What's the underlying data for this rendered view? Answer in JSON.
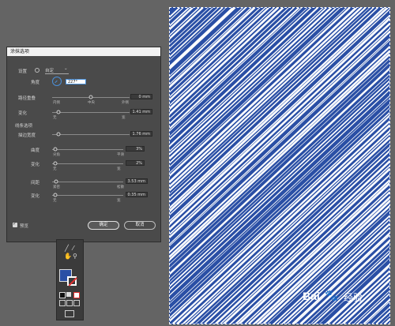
{
  "dialog": {
    "title": "涂抹选项",
    "settings_label": "设置",
    "settings_value": "自定",
    "angle_label": "角度",
    "angle_value": "227°",
    "path_overlap_label": "路径重叠",
    "path_overlap_value": "0 mm",
    "path_overlap_ticks": [
      "内侧",
      "中央",
      "外侧"
    ],
    "variation1_label": "变化",
    "variation1_value": "1.41 mm",
    "variation1_ticks": [
      "无",
      "宽"
    ],
    "line_options_label": "线条选项",
    "stroke_width_label": "描边宽度",
    "stroke_width_value": "1.76 mm",
    "curviness_label": "曲度",
    "curviness_value": "3%",
    "curviness_ticks": [
      "尖角",
      "平滑"
    ],
    "variation2_label": "变化",
    "variation2_value": "2%",
    "variation2_ticks": [
      "无",
      "宽"
    ],
    "spacing_label": "间距",
    "spacing_value": "3.53 mm",
    "spacing_ticks": [
      "紧密",
      "松散"
    ],
    "variation3_label": "变化",
    "variation3_value": "0.35 mm",
    "variation3_ticks": [
      "无",
      "宽"
    ],
    "preview_label": "预览",
    "ok_label": "确定",
    "cancel_label": "取消"
  },
  "sliders": {
    "path_overlap": 0.5,
    "variation1": 0.08,
    "stroke_width": 0.08,
    "curviness": 0.04,
    "variation2": 0.04,
    "spacing": 0.06,
    "variation3": 0.04
  },
  "colors": {
    "fill": "#2a4fa5",
    "stroke": "#ffffff",
    "accent": "#4a90d9"
  },
  "watermark": {
    "brand": "Bai",
    "brand2": "经验"
  }
}
